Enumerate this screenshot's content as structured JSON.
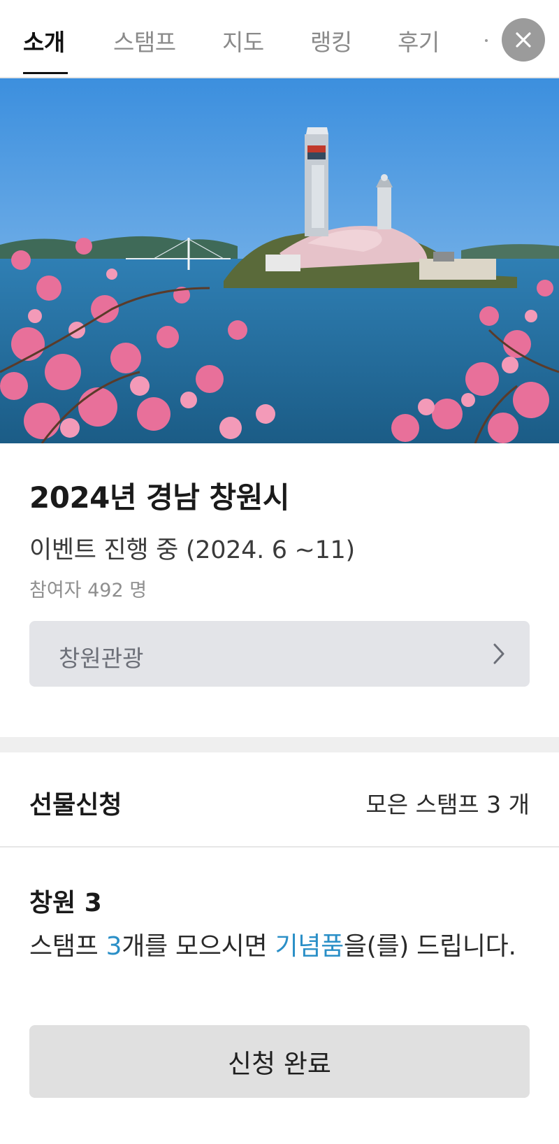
{
  "tabs": [
    {
      "label": "소개",
      "active": true
    },
    {
      "label": "스탬프",
      "active": false
    },
    {
      "label": "지도",
      "active": false
    },
    {
      "label": "랭킹",
      "active": false
    },
    {
      "label": "후기",
      "active": false
    }
  ],
  "close_icon": "close-icon",
  "event": {
    "title": "2024년 경남 창원시",
    "status": "이벤트 진행 중 (2024. 6 ~11)",
    "participants": "참여자 492 명",
    "link_label": "창원관광"
  },
  "gift": {
    "title": "선물신청",
    "stamp_summary": "모은 스탬프 3 개"
  },
  "reward": {
    "name": "창원 3",
    "desc_prefix": "스탬프 ",
    "desc_count": "3",
    "desc_mid": "개를 모으시면 ",
    "desc_item": "기념품",
    "desc_suffix": "을(를) 드립니다."
  },
  "button": {
    "label": "신청 완료"
  },
  "colors": {
    "accent": "#2a8fc7",
    "button_bg": "#e0e0e0",
    "link_bg": "#e3e4e8"
  }
}
